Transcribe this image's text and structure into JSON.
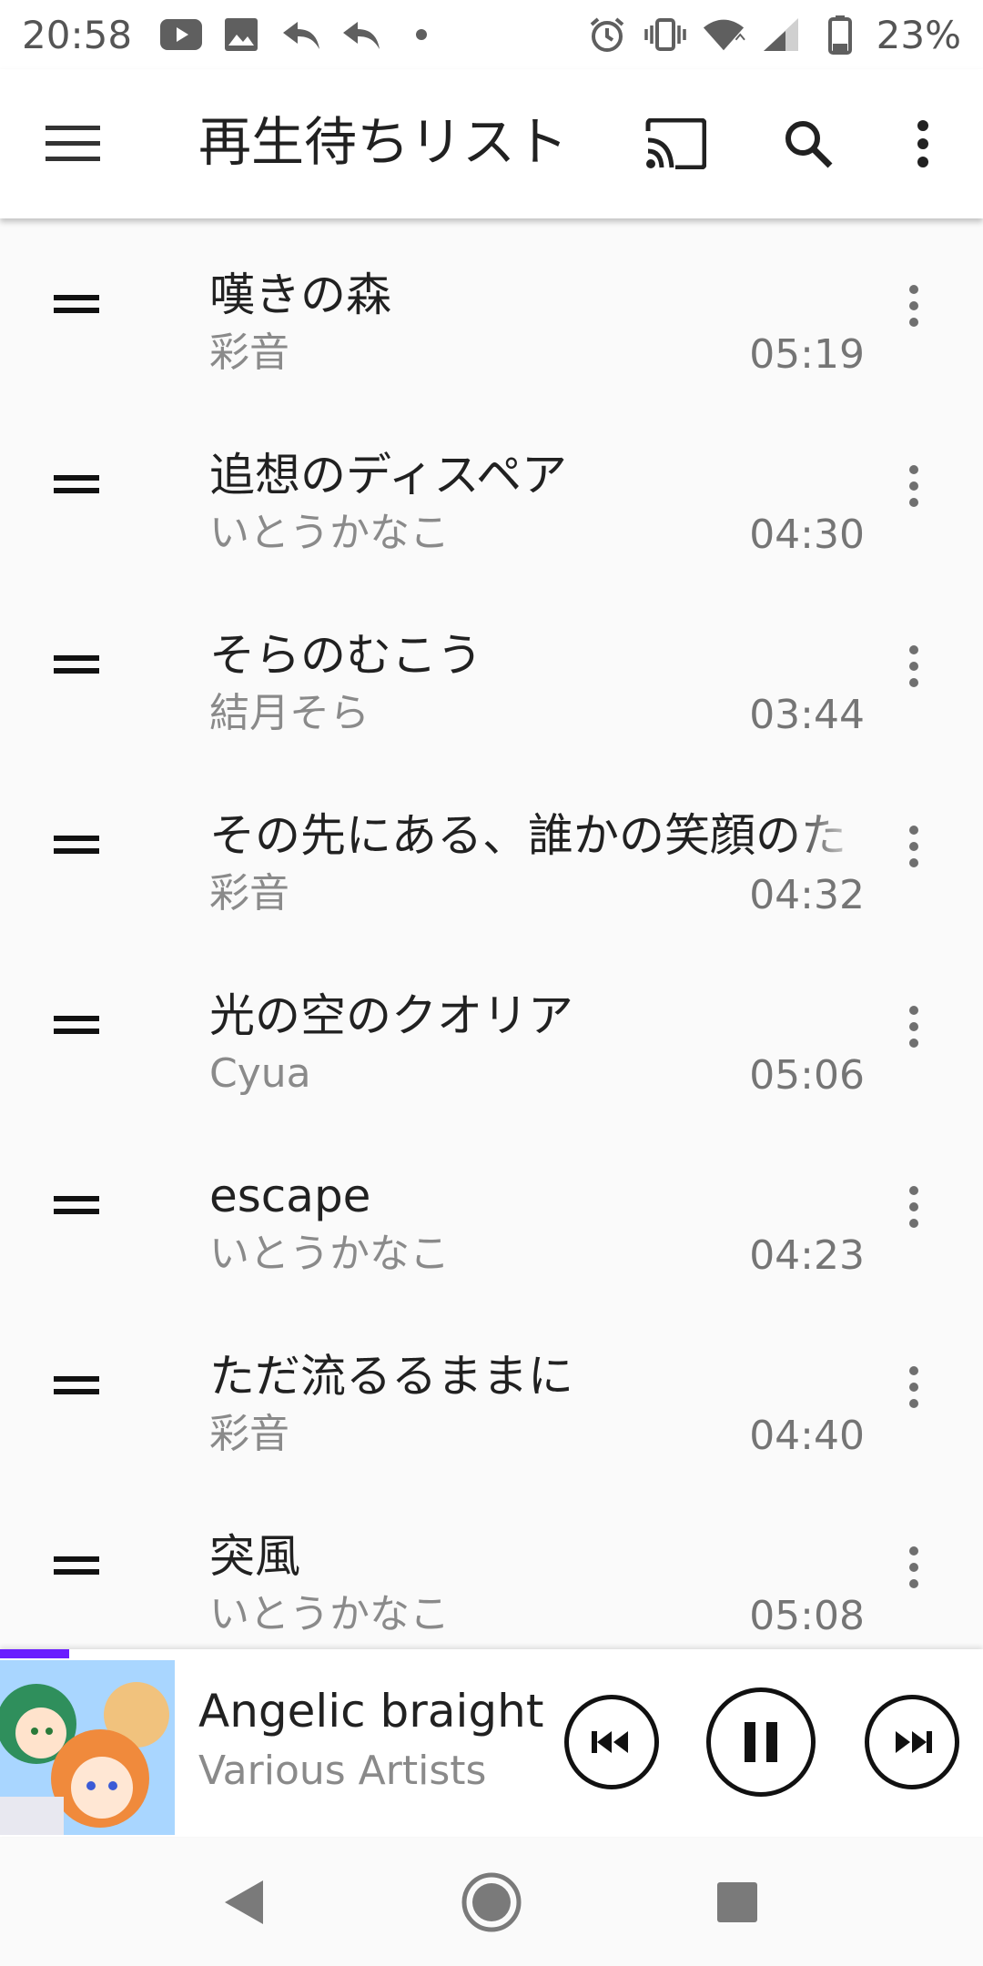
{
  "status_bar": {
    "time": "20:58",
    "battery_percent": "23%",
    "left_icons": [
      "youtube-icon",
      "image-icon",
      "reply-icon",
      "reply-icon",
      "dot-icon"
    ],
    "right_icons": [
      "alarm-icon",
      "vibrate-icon",
      "wifi-icon",
      "signal-icon",
      "battery-icon"
    ]
  },
  "app_bar": {
    "title": "再生待ちリスト",
    "icons": [
      "menu-icon",
      "cast-icon",
      "search-icon",
      "more-vert-icon"
    ]
  },
  "queue": {
    "items": [
      {
        "title": "嘆きの森",
        "artist": "彩音",
        "duration": "05:19"
      },
      {
        "title": "追想のディスペア",
        "artist": "いとうかなこ",
        "duration": "04:30"
      },
      {
        "title": "そらのむこう",
        "artist": "結月そら",
        "duration": "03:44"
      },
      {
        "title": "その先にある、誰かの笑顔のた",
        "artist": "彩音",
        "duration": "04:32"
      },
      {
        "title": "光の空のクオリア",
        "artist": "Cyua",
        "duration": "05:06"
      },
      {
        "title": "escape",
        "artist": "いとうかなこ",
        "duration": "04:23"
      },
      {
        "title": "ただ流るるままに",
        "artist": "彩音",
        "duration": "04:40"
      },
      {
        "title": "突風",
        "artist": "いとうかなこ",
        "duration": "05:08"
      }
    ]
  },
  "mini_player": {
    "title": "Angelic braight",
    "artist": "Various Artists",
    "progress_percent": 7,
    "accent_color": "#6a1dff"
  },
  "colors": {
    "primary_text": "#212121",
    "secondary_text": "#8a8a8a",
    "background": "#fafafa",
    "accent": "#6a1dff"
  }
}
